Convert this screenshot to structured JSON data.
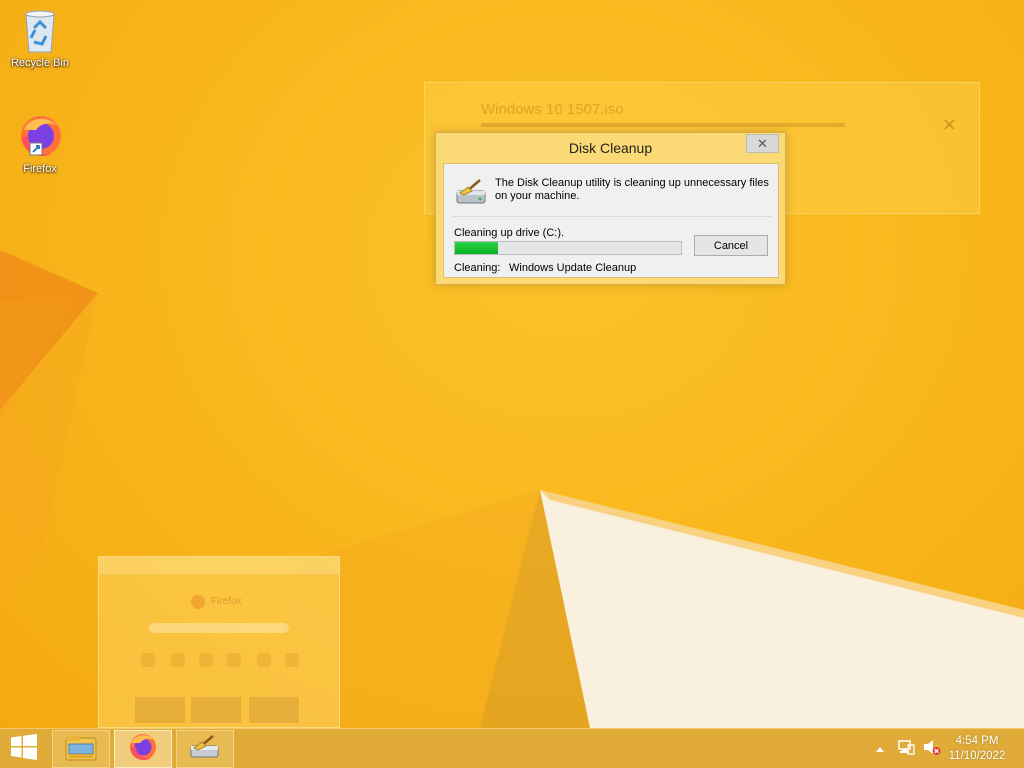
{
  "desktop": {
    "icons": [
      {
        "label": "Recycle Bin",
        "icon": "recycle-bin-icon"
      },
      {
        "label": "Firefox",
        "icon": "firefox-icon"
      }
    ]
  },
  "ghost_download": {
    "title": "Windows 10 1507.iso"
  },
  "ghost_browser": {
    "name": "Firefox"
  },
  "dialog": {
    "title": "Disk Cleanup",
    "close_label": "✕",
    "description": "The Disk Cleanup utility is cleaning up unnecessary files on your machine.",
    "drive_text": "Cleaning up drive  (C:).",
    "progress": 0.19,
    "cancel_label": "Cancel",
    "status_key": "Cleaning:",
    "status_value": "Windows Update Cleanup"
  },
  "taskbar": {
    "buttons": [
      {
        "name": "file-explorer",
        "icon": "file-explorer-icon"
      },
      {
        "name": "firefox",
        "icon": "firefox-icon",
        "active": true
      },
      {
        "name": "disk-cleanup",
        "icon": "disk-cleanup-icon"
      }
    ],
    "tray": {
      "time": "4:54 PM",
      "date": "11/10/2022",
      "icons": [
        "chevron-up-icon",
        "network-icon",
        "volume-muted-icon"
      ]
    }
  },
  "colors": {
    "wallpaper": "#f9b81e",
    "progress_fill": "#06b025",
    "dialog_frame": "#fbd974"
  }
}
